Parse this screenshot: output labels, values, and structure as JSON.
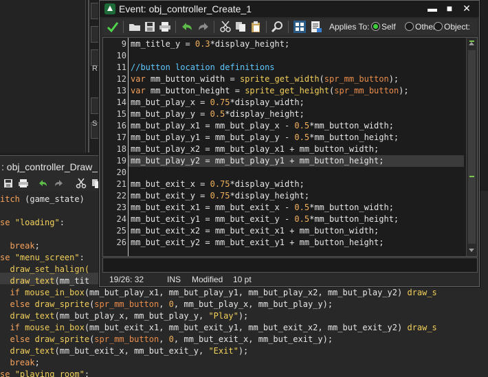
{
  "background_editor": {
    "title": ": obj_controller_Draw_",
    "side_letters": [
      "R",
      "S"
    ],
    "lines": [
      [
        {
          "t": "itch ",
          "c": "kw"
        },
        {
          "t": "(game_state)",
          "c": "id"
        }
      ],
      [],
      [
        {
          "t": "se ",
          "c": "kw"
        },
        {
          "t": "\"loading\"",
          "c": "str"
        },
        {
          "t": ":",
          "c": "id"
        }
      ],
      [],
      [
        {
          "t": "  break",
          "c": "kw"
        },
        {
          "t": ";",
          "c": "id"
        }
      ],
      [
        {
          "t": "se ",
          "c": "kw"
        },
        {
          "t": "\"menu_screen\"",
          "c": "str"
        },
        {
          "t": ":",
          "c": "id"
        }
      ],
      [
        {
          "t": "  draw_set_halign(",
          "c": "fn"
        }
      ],
      [
        {
          "t": "  draw_text",
          "c": "fn"
        },
        {
          "t": "(mm_tit",
          "c": "id"
        }
      ],
      [
        {
          "t": "  if ",
          "c": "kw"
        },
        {
          "t": "mouse_in_box",
          "c": "fn"
        },
        {
          "t": "(mm_but_play_x1, mm_but_play_y1, mm_but_play_x2, mm_but_play_y2) ",
          "c": "id"
        },
        {
          "t": "draw_s",
          "c": "fn"
        }
      ],
      [
        {
          "t": "  else ",
          "c": "kw"
        },
        {
          "t": "draw_sprite",
          "c": "fn"
        },
        {
          "t": "(",
          "c": "id"
        },
        {
          "t": "spr_mm_button",
          "c": "res"
        },
        {
          "t": ", ",
          "c": "id"
        },
        {
          "t": "0",
          "c": "num"
        },
        {
          "t": ", mm_but_play_x, mm_but_play_y);",
          "c": "id"
        }
      ],
      [
        {
          "t": "  draw_text",
          "c": "fn"
        },
        {
          "t": "(mm_but_play_x, mm_but_play_y, ",
          "c": "id"
        },
        {
          "t": "\"Play\"",
          "c": "str"
        },
        {
          "t": ");",
          "c": "id"
        }
      ],
      [
        {
          "t": "  if ",
          "c": "kw"
        },
        {
          "t": "mouse_in_box",
          "c": "fn"
        },
        {
          "t": "(mm_but_exit_x1, mm_but_exit_y1, mm_but_exit_x2, mm_but_exit_y2) ",
          "c": "id"
        },
        {
          "t": "draw_s",
          "c": "fn"
        }
      ],
      [
        {
          "t": "  else ",
          "c": "kw"
        },
        {
          "t": "draw_sprite",
          "c": "fn"
        },
        {
          "t": "(",
          "c": "id"
        },
        {
          "t": "spr_mm_button",
          "c": "res"
        },
        {
          "t": ", ",
          "c": "id"
        },
        {
          "t": "0",
          "c": "num"
        },
        {
          "t": ", mm_but_exit_x, mm_but_exit_y);",
          "c": "id"
        }
      ],
      [
        {
          "t": "  draw_text",
          "c": "fn"
        },
        {
          "t": "(mm_but_exit_x, mm_but_exit_y, ",
          "c": "id"
        },
        {
          "t": "\"Exit\"",
          "c": "str"
        },
        {
          "t": ");",
          "c": "id"
        }
      ],
      [
        {
          "t": "  break",
          "c": "kw"
        },
        {
          "t": ";",
          "c": "id"
        }
      ],
      [
        {
          "t": "se ",
          "c": "kw"
        },
        {
          "t": "\"playing_room\"",
          "c": "str"
        },
        {
          "t": ":",
          "c": "id"
        }
      ]
    ]
  },
  "window": {
    "title": "Event: obj_controller_Create_1",
    "minimize": "▬",
    "maximize": "■",
    "close": "✕",
    "applies_to_label": "Applies To:",
    "radio_options": [
      "Self",
      "Other",
      "Object:"
    ],
    "radio_selected": "Self"
  },
  "editor": {
    "line_numbers": [
      "9",
      "10",
      "11",
      "12",
      "13",
      "14",
      "15",
      "16",
      "17",
      "18",
      "19",
      "20",
      "21",
      "22",
      "23",
      "24",
      "25",
      "26"
    ],
    "current_line_index": 10,
    "lines": [
      [
        {
          "t": "mm_title_y = ",
          "c": "id"
        },
        {
          "t": "0.3",
          "c": "num"
        },
        {
          "t": "*display_height;",
          "c": "id"
        }
      ],
      [],
      [
        {
          "t": "//button location definitions",
          "c": "cmt"
        }
      ],
      [
        {
          "t": "var ",
          "c": "kw"
        },
        {
          "t": "mm_button_width = ",
          "c": "id"
        },
        {
          "t": "sprite_get_width",
          "c": "fn"
        },
        {
          "t": "(",
          "c": "id"
        },
        {
          "t": "spr_mm_button",
          "c": "res"
        },
        {
          "t": ");",
          "c": "id"
        }
      ],
      [
        {
          "t": "var ",
          "c": "kw"
        },
        {
          "t": "mm_button_height = ",
          "c": "id"
        },
        {
          "t": "sprite_get_height",
          "c": "fn"
        },
        {
          "t": "(",
          "c": "id"
        },
        {
          "t": "spr_mm_button",
          "c": "res"
        },
        {
          "t": ");",
          "c": "id"
        }
      ],
      [
        {
          "t": "mm_but_play_x = ",
          "c": "id"
        },
        {
          "t": "0.75",
          "c": "num"
        },
        {
          "t": "*display_width;",
          "c": "id"
        }
      ],
      [
        {
          "t": "mm_but_play_y = ",
          "c": "id"
        },
        {
          "t": "0.5",
          "c": "num"
        },
        {
          "t": "*display_height;",
          "c": "id"
        }
      ],
      [
        {
          "t": "mm_but_play_x1 = mm_but_play_x - ",
          "c": "id"
        },
        {
          "t": "0.5",
          "c": "num"
        },
        {
          "t": "*mm_button_width;",
          "c": "id"
        }
      ],
      [
        {
          "t": "mm_but_play_y1 = mm_but_play_y - ",
          "c": "id"
        },
        {
          "t": "0.5",
          "c": "num"
        },
        {
          "t": "*mm_button_height;",
          "c": "id"
        }
      ],
      [
        {
          "t": "mm_but_play_x2 = mm_but_play_x1 + mm_button_width;",
          "c": "id"
        }
      ],
      [
        {
          "t": "mm_but_play_y2 = mm_but_play_y1 + mm_button_height;",
          "c": "id"
        }
      ],
      [],
      [
        {
          "t": "mm_but_exit_x = ",
          "c": "id"
        },
        {
          "t": "0.75",
          "c": "num"
        },
        {
          "t": "*display_width;",
          "c": "id"
        }
      ],
      [
        {
          "t": "mm_but_exit_y = ",
          "c": "id"
        },
        {
          "t": "0.75",
          "c": "num"
        },
        {
          "t": "*display_height;",
          "c": "id"
        }
      ],
      [
        {
          "t": "mm_but_exit_x1 = mm_but_exit_x - ",
          "c": "id"
        },
        {
          "t": "0.5",
          "c": "num"
        },
        {
          "t": "*mm_button_width;",
          "c": "id"
        }
      ],
      [
        {
          "t": "mm_but_exit_y1 = mm_but_exit_y - ",
          "c": "id"
        },
        {
          "t": "0.5",
          "c": "num"
        },
        {
          "t": "*mm_button_height;",
          "c": "id"
        }
      ],
      [
        {
          "t": "mm_but_exit_x2 = mm_but_exit_x1 + mm_button_width;",
          "c": "id"
        }
      ],
      [
        {
          "t": "mm_but_exit_y2 = mm_but_exit_y1 + mm_button_height;",
          "c": "id"
        }
      ]
    ]
  },
  "status_bar": {
    "position": "19/26:  32",
    "mode": "INS",
    "state": "Modified",
    "font_size": "10 pt"
  },
  "colors": {
    "keyword": "#f7a35c",
    "string": "#f5d25a",
    "comment": "#5ec8ff",
    "function": "#f3cf5a",
    "resource": "#e98c4a",
    "accent_green": "#3bd03b"
  }
}
